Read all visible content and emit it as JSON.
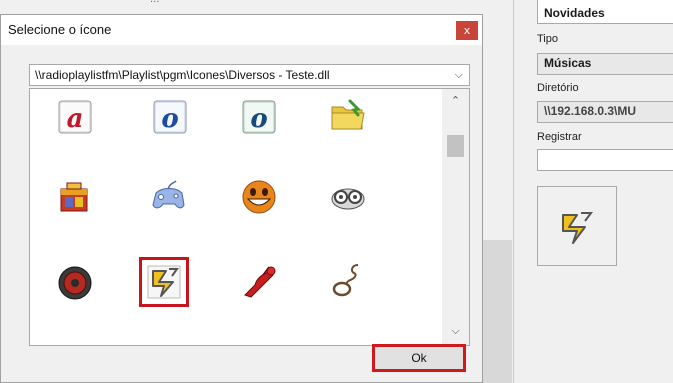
{
  "dialog": {
    "title": "Selecione o ícone",
    "close_label": "x",
    "path": "\\\\radioplaylistfm\\Playlist\\pgm\\Icones\\Diversos - Teste.dll",
    "ok_label": "Ok",
    "icons": [
      {
        "name": "letter-a-icon",
        "glyph": "a"
      },
      {
        "name": "letter-o-icon",
        "glyph": "o"
      },
      {
        "name": "letter-o-icon-2",
        "glyph": "o"
      },
      {
        "name": "folder-icon"
      },
      {
        "name": "toolbox-icon"
      },
      {
        "name": "gamepad-icon"
      },
      {
        "name": "smiley-icon"
      },
      {
        "name": "reels-icon"
      },
      {
        "name": "speaker-icon"
      },
      {
        "name": "winamp-icon",
        "selected": true
      },
      {
        "name": "lobster-icon"
      },
      {
        "name": "rope-icon"
      }
    ]
  },
  "right_panel": {
    "top_value": "Novidades",
    "tipo_label": "Tipo",
    "tipo_value": "Músicas",
    "diretorio_label": "Diretório",
    "diretorio_value": "\\\\192.168.0.3\\MU",
    "registrar_label": "Registrar",
    "registrar_value": ""
  },
  "colors": {
    "close_button": "#c9443a",
    "highlight_red": "#d0191f"
  }
}
